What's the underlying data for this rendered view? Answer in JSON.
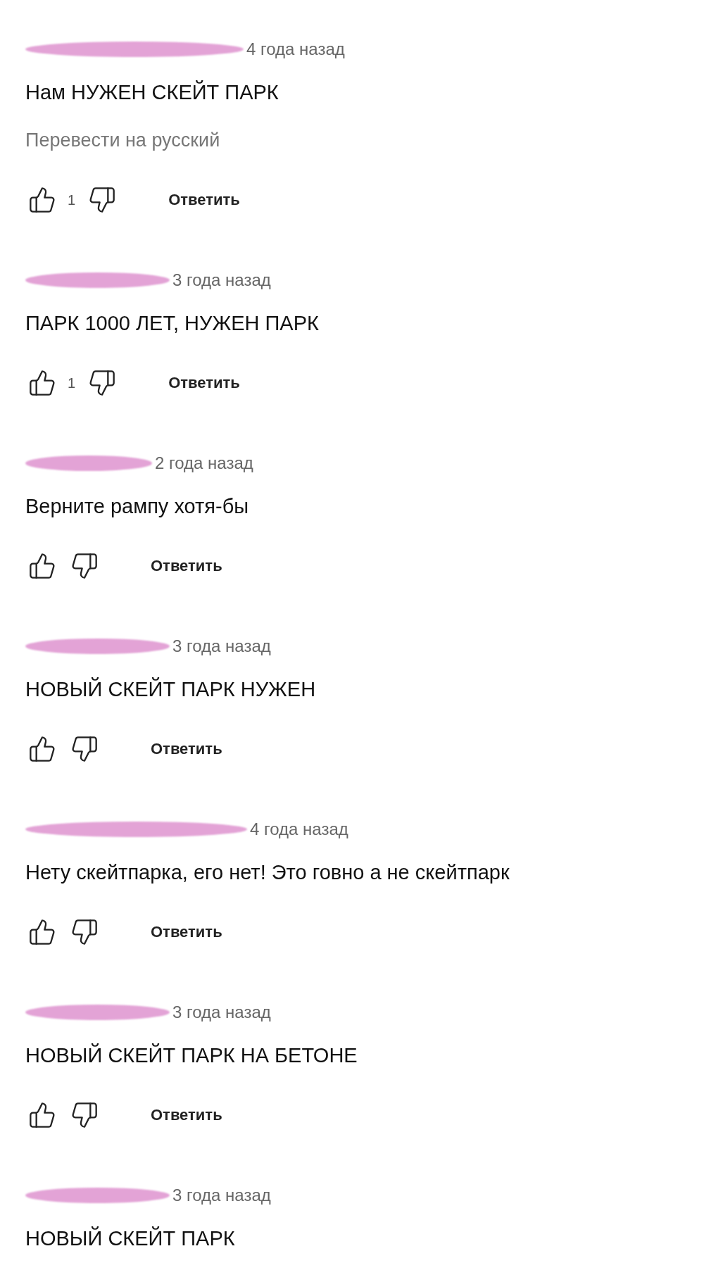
{
  "comments": [
    {
      "time": "4 года назад",
      "text": "Нам НУЖЕН СКЕЙТ ПАРК",
      "translate": "Перевести на русский",
      "actions": {
        "likes": "1",
        "reply": "Ответить"
      }
    },
    {
      "time": "3 года назад",
      "text": "ПАРК 1000 ЛЕТ, НУЖЕН ПАРК",
      "actions": {
        "likes": "1",
        "reply": "Ответить"
      }
    },
    {
      "time": "2 года назад",
      "text": "Верните рампу хотя-бы",
      "actions": {
        "reply": "Ответить"
      }
    },
    {
      "time": "3 года назад",
      "text": "НОВЫЙ СКЕЙТ ПАРК НУЖЕН",
      "actions": {
        "reply": "Ответить"
      }
    },
    {
      "time": "4 года назад",
      "text": "Нету скейтпарка, его нет! Это говно а не скейтпарк",
      "actions": {
        "reply": "Ответить"
      }
    },
    {
      "time": "3 года назад",
      "text": "НОВЫЙ СКЕЙТ ПАРК НА БЕТОНЕ",
      "actions": {
        "reply": "Ответить"
      }
    },
    {
      "time": "3 года назад",
      "text": "НОВЫЙ СКЕЙТ ПАРК"
    }
  ]
}
